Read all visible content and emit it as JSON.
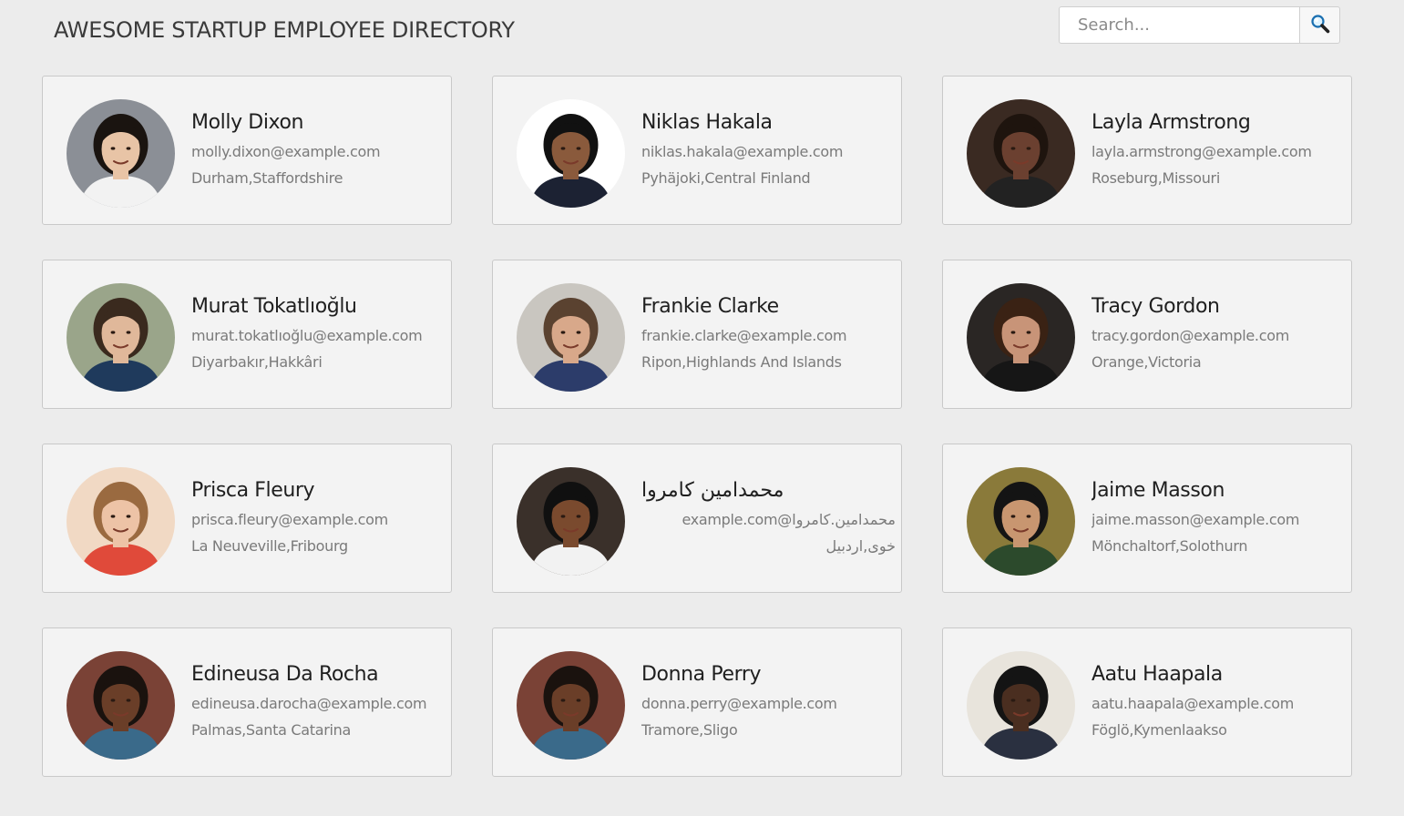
{
  "header": {
    "title": "AWESOME STARTUP EMPLOYEE DIRECTORY"
  },
  "search": {
    "placeholder": "Search...",
    "value": "",
    "button_icon": "magnifier-icon"
  },
  "employees": [
    {
      "name": "Molly Dixon",
      "email": "molly.dixon@example.com",
      "location": "Durham,Staffordshire",
      "avatar": {
        "bg": "#8b8f96",
        "hair": "#1a1410",
        "skin": "#e8c4a6",
        "shirt": "#f2f2f2"
      }
    },
    {
      "name": "Niklas Hakala",
      "email": "niklas.hakala@example.com",
      "location": "Pyhäjoki,Central Finland",
      "avatar": {
        "bg": "#ffffff",
        "hair": "#111111",
        "skin": "#8a5a3c",
        "shirt": "#1c2233"
      }
    },
    {
      "name": "Layla Armstrong",
      "email": "layla.armstrong@example.com",
      "location": "Roseburg,Missouri",
      "avatar": {
        "bg": "#3a2a22",
        "hair": "#1e140e",
        "skin": "#6b4030",
        "shirt": "#222222"
      }
    },
    {
      "name": "Murat Tokatlıoğlu",
      "email": "murat.tokatlıoğlu@example.com",
      "location": "Diyarbakır,Hakkâri",
      "avatar": {
        "bg": "#9aa58a",
        "hair": "#3a2a1e",
        "skin": "#e0b89a",
        "shirt": "#1f3a5c"
      }
    },
    {
      "name": "Frankie Clarke",
      "email": "frankie.clarke@example.com",
      "location": "Ripon,Highlands And Islands",
      "avatar": {
        "bg": "#c9c6c0",
        "hair": "#5a4230",
        "skin": "#d8a88a",
        "shirt": "#2c3c6a"
      }
    },
    {
      "name": "Tracy Gordon",
      "email": "tracy.gordon@example.com",
      "location": "Orange,Victoria",
      "avatar": {
        "bg": "#2a2624",
        "hair": "#3a2214",
        "skin": "#c89478",
        "shirt": "#161616"
      }
    },
    {
      "name": "Prisca Fleury",
      "email": "prisca.fleury@example.com",
      "location": "La Neuveville,Fribourg",
      "avatar": {
        "bg": "#f1d9c4",
        "hair": "#9a6a40",
        "skin": "#edc3a6",
        "shirt": "#e04a3a"
      }
    },
    {
      "name": "محمدامین كامروا",
      "email": "محمدامین.كامروا@example.com",
      "location": "خوی,اردبیل",
      "avatar": {
        "bg": "#3a302a",
        "hair": "#101010",
        "skin": "#7a4a2e",
        "shirt": "#f2f2f2"
      }
    },
    {
      "name": "Jaime Masson",
      "email": "jaime.masson@example.com",
      "location": "Mönchaltorf,Solothurn",
      "avatar": {
        "bg": "#8a7a3a",
        "hair": "#141414",
        "skin": "#c89670",
        "shirt": "#2c4a2c"
      }
    },
    {
      "name": "Edineusa Da Rocha",
      "email": "edineusa.darocha@example.com",
      "location": "Palmas,Santa Catarina",
      "avatar": {
        "bg": "#7a4236",
        "hair": "#1a120e",
        "skin": "#6a3e28",
        "shirt": "#3a6a8a"
      }
    },
    {
      "name": "Donna Perry",
      "email": "donna.perry@example.com",
      "location": "Tramore,Sligo",
      "avatar": {
        "bg": "#7a4236",
        "hair": "#1a120e",
        "skin": "#6a3e28",
        "shirt": "#3a6a8a"
      }
    },
    {
      "name": "Aatu Haapala",
      "email": "aatu.haapala@example.com",
      "location": "Föglö,Kymenlaakso",
      "avatar": {
        "bg": "#e8e4dc",
        "hair": "#141414",
        "skin": "#4a2e20",
        "shirt": "#2a3040"
      }
    }
  ]
}
